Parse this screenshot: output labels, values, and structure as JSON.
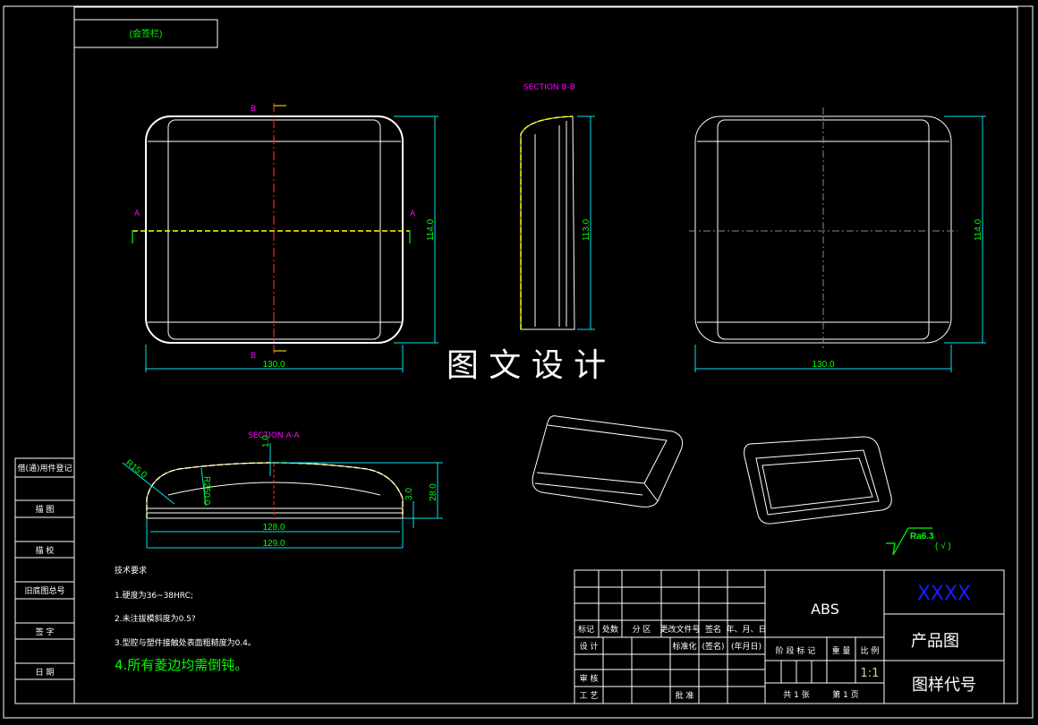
{
  "sign_box": {
    "label": "(会签栏)"
  },
  "left_strip": [
    "借(通)用件登记",
    "描 图",
    "描 校",
    "旧底图总号",
    "签 字",
    "日 期"
  ],
  "views": {
    "section_bb": "SECTION B-B",
    "section_aa": "SECTION A-A",
    "cut_a": "A",
    "cut_b": "B",
    "front_width": "130.0",
    "front_height": "114.0",
    "side_height": "113.0",
    "right_width": "130.0",
    "right_height": "114.0",
    "aa_radius1": "R15.0",
    "aa_radius2": "R250.0",
    "aa_top": "1.0",
    "aa_wall": "3.0",
    "aa_height": "28.0",
    "aa_inner_width": "128.0",
    "aa_outer_width": "129.0"
  },
  "watermark": "图 文 设 计",
  "roughness": {
    "symbol": "Ra6.3",
    "other": "( √ )"
  },
  "tech": {
    "title": "技术要求",
    "items": [
      "1.硬度为36~38HRC;",
      "2.未注拔模斜度为0.5?",
      "3.型腔与塑件接触处表面粗糙度为0.4。",
      "4.所有菱边均需倒钝。"
    ]
  },
  "title_block": {
    "header": [
      "标记",
      "处数",
      "分 区",
      "更改文件号",
      "签名",
      "年、月、日"
    ],
    "design": "设 计",
    "standard": "标准化",
    "sign": "(签名)",
    "date": "(年月日)",
    "review": "审 核",
    "process": "工 艺",
    "approve": "批 准",
    "stage_mark": "阶 段 标 记",
    "quantity": "重 量",
    "scale_label": "比 例",
    "scale": "1:1",
    "sheets": "共 1 张",
    "sheet_no": "第 1 页",
    "material": "ABS",
    "company": "XXXX",
    "drawing_name": "产品图",
    "drawing_code": "图样代号"
  },
  "colors": {
    "background": "#000000",
    "line": "#ffffff",
    "dimension": "#00e5ee",
    "dim_text": "#00ff00",
    "section_label": "#ff00ff",
    "company": "#1a1aff"
  }
}
